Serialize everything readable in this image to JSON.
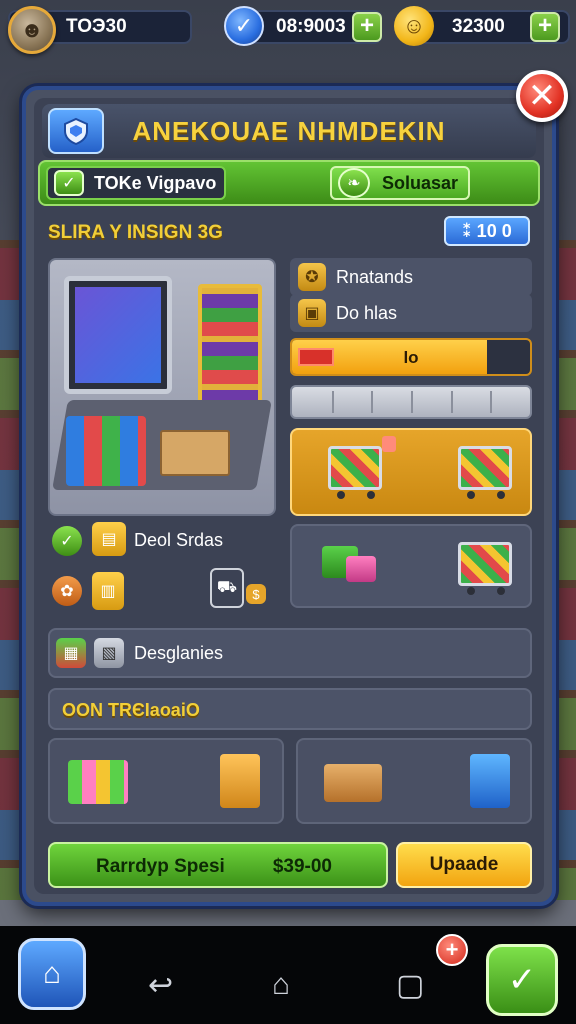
{
  "hud": {
    "player_value": "TOЭ30",
    "gems_value": "08:9003",
    "coins_value": "32300"
  },
  "panel": {
    "title": "ANEKOUAE NHMDEKIN",
    "close_glyph": "✕",
    "tabs": [
      {
        "label": "TOKe Vigpavo"
      },
      {
        "label": "Soluasar"
      }
    ],
    "section_heading": "SLIRA Y INSIGN 3G",
    "count_badge": "⁑ 10 0",
    "stats": [
      {
        "label": "Rnatands",
        "icon": "badge-icon"
      },
      {
        "label": "Do hlas",
        "icon": "crate-icon"
      }
    ],
    "progress": {
      "label": "lo",
      "value": 0.82,
      "color": "#f2a10f"
    },
    "segment_bar": {
      "segments": 6
    },
    "items_row_1": {
      "label": "Deol Srdas"
    },
    "items_row_2": {
      "label": "Desglanies"
    },
    "subsection_heading": "OON TRЄIaoaiO",
    "bottom_buttons": {
      "main_left": "Rarrdyp Spesi",
      "main_right": "$39-00",
      "upgrade": "Upaade"
    }
  },
  "nav": {
    "back_glyph": "↩",
    "home_glyph": "⌂",
    "recent_glyph": "▢",
    "plus_glyph": "+",
    "check_glyph": "✓"
  },
  "colors": {
    "accent_green": "#4caa22",
    "title_gold": "#f7d23e",
    "panel_border": "#2c4a8c",
    "close_red": "#e23224"
  }
}
